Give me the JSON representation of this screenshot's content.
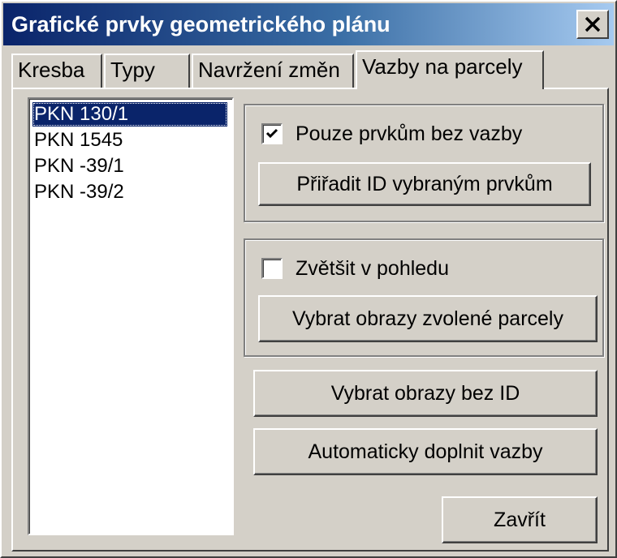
{
  "window": {
    "title": "Grafické prvky geometrického plánu",
    "close_glyph": "✕"
  },
  "tabs": [
    {
      "label": "Kresba",
      "active": false
    },
    {
      "label": "Typy",
      "active": false
    },
    {
      "label": "Navržení změn",
      "active": false
    },
    {
      "label": "Vazby na parcely",
      "active": true
    }
  ],
  "parcel_list": {
    "items": [
      "PKN 130/1",
      "PKN 1545",
      "PKN -39/1",
      "PKN -39/2"
    ],
    "selected_index": 0
  },
  "group_assign": {
    "checkbox_label": "Pouze prvkům bez vazby",
    "checkbox_checked": true,
    "button_label": "Přiřadit ID vybraným prvkům"
  },
  "group_select": {
    "checkbox_label": "Zvětšit v pohledu",
    "checkbox_checked": false,
    "button_label": "Vybrat obrazy zvolené parcely"
  },
  "buttons": {
    "select_without_id": "Vybrat obrazy bez ID",
    "auto_fill": "Automaticky doplnit vazby",
    "close": "Zavřít"
  },
  "colors": {
    "face": "#d4d0c8",
    "title_gradient_start": "#0a246a",
    "title_gradient_end": "#a6caf0",
    "selection": "#0a246a"
  }
}
